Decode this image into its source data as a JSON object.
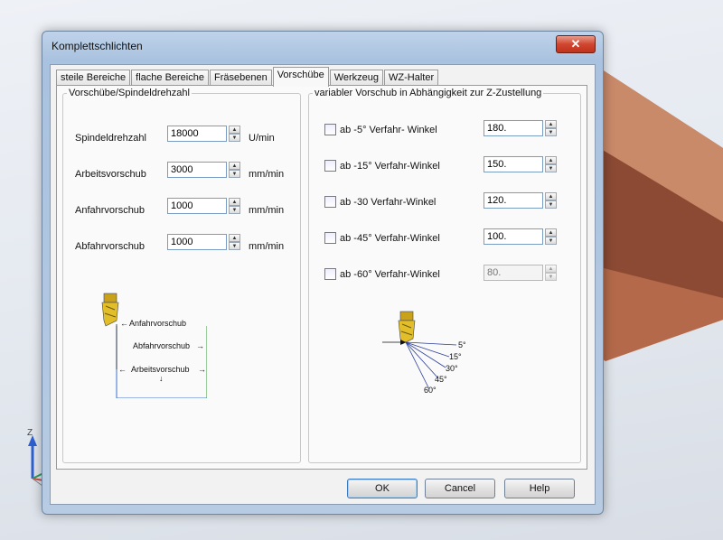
{
  "window": {
    "title": "Komplettschlichten",
    "close_label": "✕"
  },
  "tabs": [
    {
      "label": "steile Bereiche"
    },
    {
      "label": "flache Bereiche"
    },
    {
      "label": "Fräsebenen"
    },
    {
      "label": "Vorschübe",
      "active": true
    },
    {
      "label": "Werkzeug"
    },
    {
      "label": "WZ-Halter"
    }
  ],
  "left_group": {
    "legend": "Vorschübe/Spindeldrehzahl",
    "fields": [
      {
        "label": "Spindeldrehzahl",
        "value": "18000",
        "unit": "U/min"
      },
      {
        "label": "Arbeitsvorschub",
        "value": "3000",
        "unit": "mm/min"
      },
      {
        "label": "Anfahrvorschub",
        "value": "1000",
        "unit": "mm/min"
      },
      {
        "label": "Abfahrvorschub",
        "value": "1000",
        "unit": "mm/min"
      }
    ],
    "diagram": {
      "anfahr": "Anfahrvorschub",
      "abfahr": "Abfahrvorschub",
      "arbeits": "Arbeitsvorschub"
    }
  },
  "right_group": {
    "legend": "variabler Vorschub in Abhängigkeit zur Z-Zustellung",
    "rows": [
      {
        "label": "ab -5°  Verfahr- Winkel",
        "value": "180.",
        "enabled": true
      },
      {
        "label": "ab -15°  Verfahr-Winkel",
        "value": "150.",
        "enabled": true
      },
      {
        "label": "ab -30  Verfahr-Winkel",
        "value": "120.",
        "enabled": true
      },
      {
        "label": "ab -45°  Verfahr-Winkel",
        "value": "100.",
        "enabled": true
      },
      {
        "label": "ab -60°  Verfahr-Winkel",
        "value": "80.",
        "enabled": false
      }
    ],
    "diagram": {
      "a5": "5°",
      "a15": "15°",
      "a30": "30°",
      "a45": "45°",
      "a60": "60°"
    }
  },
  "buttons": {
    "ok": "OK",
    "cancel": "Cancel",
    "help": "Help"
  },
  "axis": {
    "z": "Z"
  },
  "colors": {
    "tool_gold": "#d8b31c",
    "window_frame": "#b7cbe3",
    "wood": "#a0522d"
  }
}
